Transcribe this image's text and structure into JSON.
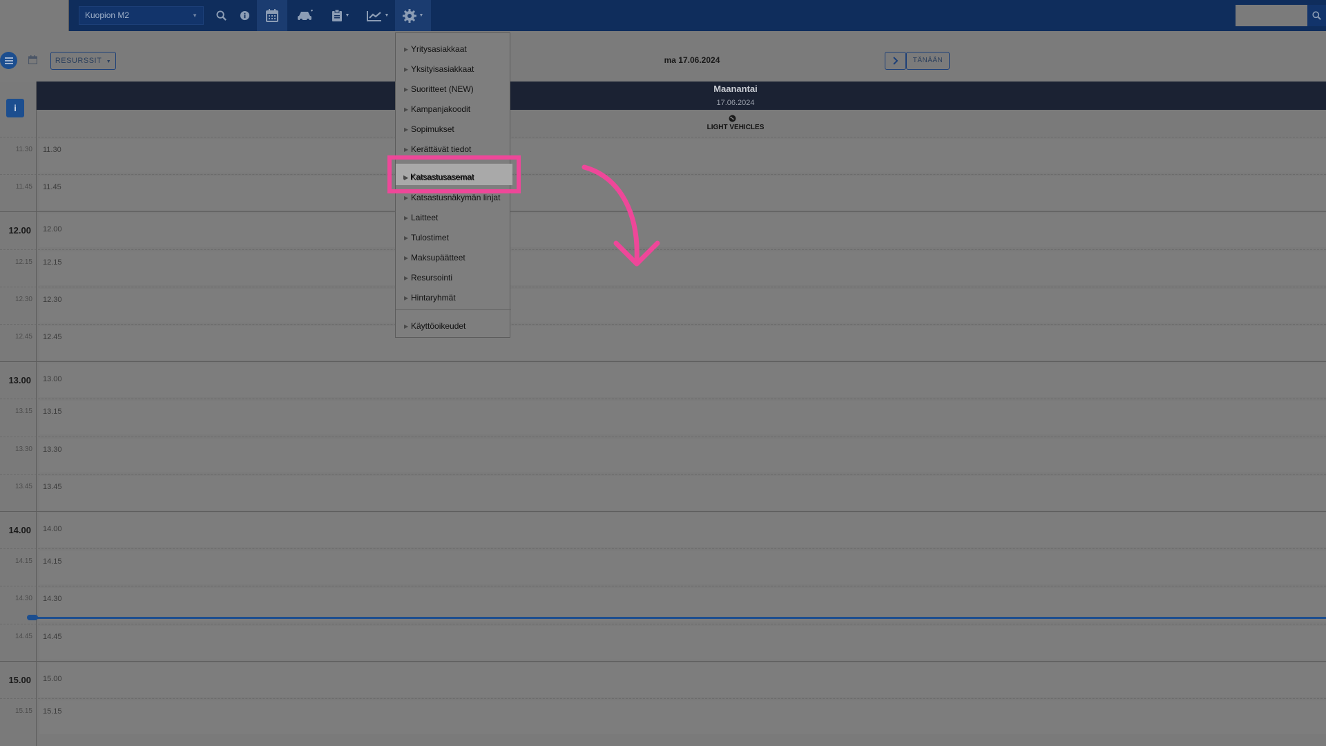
{
  "topbar": {
    "station": "Kuopion M2",
    "icons": [
      "search-icon",
      "info-icon",
      "calendar-icon",
      "car-icon",
      "clipboard-icon",
      "chart-icon",
      "gear-icon",
      "search-icon"
    ]
  },
  "toolbar": {
    "resources_label": "RESURSSIT",
    "date_label": "ma 17.06.2024",
    "today_label": "TÄNÄÄN"
  },
  "day": {
    "name": "Maanantai",
    "date": "17.06.2024",
    "resource": "LIGHT VEHICLES",
    "info": "i"
  },
  "grid": {
    "slots": [
      {
        "gutter": "11.30",
        "label": "11.30"
      },
      {
        "gutter": "11.45",
        "label": "11.45"
      },
      {
        "gutter": "12.00",
        "label": "12.00"
      },
      {
        "gutter": "12.15",
        "label": "12.15"
      },
      {
        "gutter": "12.30",
        "label": "12.30"
      },
      {
        "gutter": "12.45",
        "label": "12.45"
      },
      {
        "gutter": "13.00",
        "label": "13.00"
      },
      {
        "gutter": "13.15",
        "label": "13.15"
      },
      {
        "gutter": "13.30",
        "label": "13.30"
      },
      {
        "gutter": "13.45",
        "label": "13.45"
      },
      {
        "gutter": "14.00",
        "label": "14.00"
      },
      {
        "gutter": "14.15",
        "label": "14.15"
      },
      {
        "gutter": "14.30",
        "label": "14.30"
      },
      {
        "gutter": "14.45",
        "label": "14.45"
      },
      {
        "gutter": "15.00",
        "label": "15.00"
      },
      {
        "gutter": "15.15",
        "label": "15.15"
      }
    ]
  },
  "settings_menu": {
    "items": [
      {
        "label": "Yritysasiakkaat"
      },
      {
        "label": "Yksityisasiakkaat"
      },
      {
        "label": "Suoritteet (NEW)"
      },
      {
        "label": "Kampanjakoodit"
      },
      {
        "label": "Sopimukset"
      },
      {
        "label": "Kerättävät tiedot"
      },
      {
        "label": "Katsastusasemat"
      },
      {
        "label": "Katsastusnäkymän linjat"
      },
      {
        "label": "Laitteet"
      },
      {
        "label": "Tulostimet"
      },
      {
        "label": "Maksupäätteet"
      },
      {
        "label": "Resursointi"
      },
      {
        "label": "Hintaryhmät"
      },
      {
        "label": "Käyttöoikeudet"
      }
    ],
    "highlighted": "Katsastusasemat"
  },
  "colors": {
    "nav": "#0f2d5c",
    "accent": "#1c4e8f",
    "highlight": "#ee4799"
  }
}
